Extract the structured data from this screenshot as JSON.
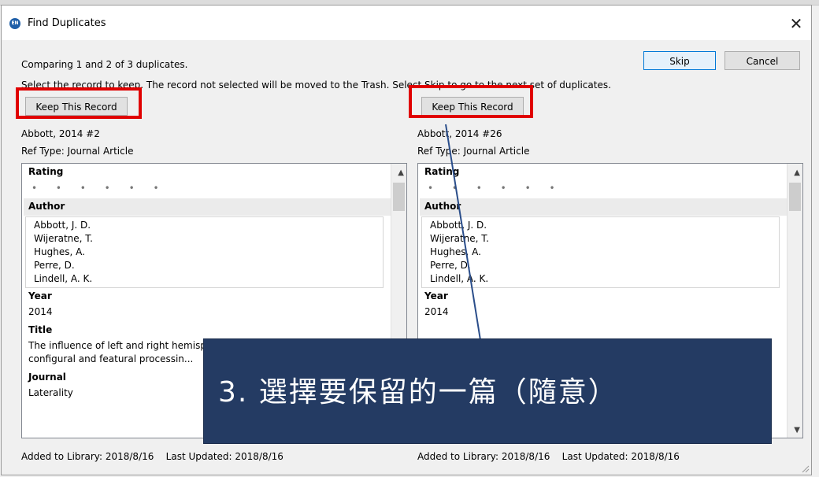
{
  "dialog": {
    "title": "Find Duplicates",
    "close_glyph": "✕",
    "status": "Comparing 1 and 2 of 3 duplicates.",
    "instruction": "Select the record to keep. The record not selected will be moved to the Trash. Select Skip to go to the next set of duplicates.",
    "skip_label": "Skip",
    "cancel_label": "Cancel",
    "app_icon": "EN"
  },
  "left": {
    "keep_label": "Keep This Record",
    "ref": "Abbott, 2014 #2",
    "ref_type": "Ref Type: Journal Article",
    "rating_label": "Rating",
    "rating_dots": "• • • • • •",
    "author_label": "Author",
    "authors": [
      "Abbott, J. D.",
      "Wijeratne, T.",
      "Hughes, A.",
      "Perre, D.",
      "Lindell, A. K."
    ],
    "year_label": "Year",
    "year": "2014",
    "title_label": "Title",
    "title_lines": [
      "The influence of left and right hemisphere ...",
      "configural and featural processin..."
    ],
    "journal_label": "Journal",
    "journal": "Laterality",
    "added": "Added to Library: 2018/8/16",
    "updated": "Last Updated: 2018/8/16"
  },
  "right": {
    "keep_label": "Keep This Record",
    "ref": "Abbott, 2014 #26",
    "ref_type": "Ref Type: Journal Article",
    "rating_label": "Rating",
    "rating_dots": "• • • • • •",
    "author_label": "Author",
    "authors": [
      "Abbott, J. D.",
      "Wijeratne, T.",
      "Hughes, A.",
      "Perre, D.",
      "Lindell, A. K."
    ],
    "year_label": "Year",
    "year": "2014",
    "added": "Added to Library: 2018/8/16",
    "updated": "Last Updated: 2018/8/16"
  },
  "annotation": {
    "text": "3.  選擇要保留的一篇（隨意）",
    "highlight_color": "#e00000",
    "box_color": "#243b63"
  }
}
